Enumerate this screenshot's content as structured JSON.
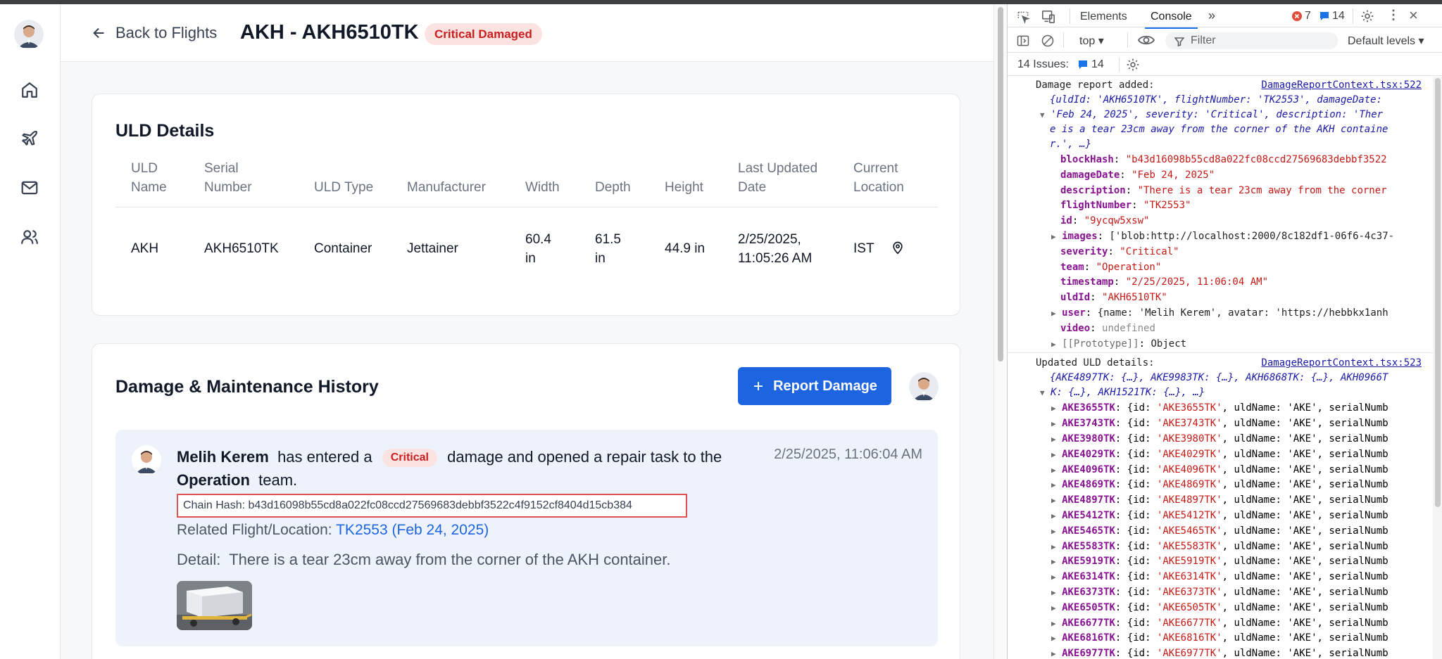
{
  "app": {
    "back_label": "Back to Flights",
    "title": "AKH - AKH6510TK",
    "status_badge": "Critical Damaged",
    "uld_section_title": "ULD Details",
    "uld_headers": [
      "ULD Name",
      "Serial Number",
      "ULD Type",
      "Manufacturer",
      "Width",
      "Depth",
      "Height",
      "Last Updated Date",
      "Current Location"
    ],
    "uld_row": {
      "name": "AKH",
      "serial": "AKH6510TK",
      "type": "Container",
      "manufacturer": "Jettainer",
      "width": "60.4 in",
      "depth": "61.5 in",
      "height": "44.9 in",
      "last_updated": "2/25/2025, 11:05:26 AM",
      "location": "IST"
    },
    "history_title": "Damage & Maintenance History",
    "report_button": "Report Damage",
    "entry": {
      "user": "Melih Kerem",
      "text_1": "has entered a",
      "severity": "Critical",
      "text_2": "damage and opened a repair task to the",
      "team": "Operation",
      "text_3": "team.",
      "timestamp": "2/25/2025, 11:06:04 AM",
      "chain_hash": "Chain Hash: b43d16098b55cd8a022fc08ccd27569683debbf3522c4f9152cf8404d15cb384",
      "related_label": "Related Flight/Location:",
      "related_value": "TK2553 (Feb 24, 2025)",
      "detail_label": "Detail:",
      "detail_text": "There is a tear 23cm away from the corner of the AKH container."
    }
  },
  "devtools": {
    "tabs": [
      "Elements",
      "Console"
    ],
    "error_count": "7",
    "message_count": "14",
    "context": "top",
    "filter_placeholder": "Filter",
    "levels": "Default levels",
    "issues_label": "14 Issues:",
    "issues_count": "14",
    "log1": {
      "label": "Damage report added:",
      "source": "DamageReportContext.tsx:522",
      "summary_1": "{uldId: 'AKH6510TK', flightNumber: 'TK2553', damageDate:",
      "summary_2": "'Feb 24, 2025', severity: 'Critical', description: 'Ther",
      "summary_3": "e is a tear 23cm away from the corner of the AKH containe",
      "summary_4": "r.', …}",
      "props": [
        {
          "key": "blockHash",
          "value": "\"b43d16098b55cd8a022fc08ccd27569683debbf3522",
          "expand": false
        },
        {
          "key": "damageDate",
          "value": "\"Feb 24, 2025\"",
          "expand": false
        },
        {
          "key": "description",
          "value": "\"There is a tear 23cm away from the corner",
          "expand": false
        },
        {
          "key": "flightNumber",
          "value": "\"TK2553\"",
          "expand": false
        },
        {
          "key": "id",
          "value": "\"9ycqw5xsw\"",
          "expand": false
        },
        {
          "key": "images",
          "value": "['blob:http://localhost:2000/8c182df1-06f6-4c37-",
          "expand": true
        },
        {
          "key": "severity",
          "value": "\"Critical\"",
          "expand": false
        },
        {
          "key": "team",
          "value": "\"Operation\"",
          "expand": false
        },
        {
          "key": "timestamp",
          "value": "\"2/25/2025, 11:06:04 AM\"",
          "expand": false
        },
        {
          "key": "uldId",
          "value": "\"AKH6510TK\"",
          "expand": false
        },
        {
          "key": "user",
          "value": "{name: 'Melih Kerem', avatar: 'https://hebbkx1anh",
          "expand": true
        },
        {
          "key": "video",
          "value": "undefined",
          "expand": false
        },
        {
          "key": "[[Prototype]]",
          "value": "Object",
          "expand": true
        }
      ]
    },
    "log2": {
      "label": "Updated ULD details:",
      "source": "DamageReportContext.tsx:523",
      "summary_1": "{AKE4897TK: {…}, AKE9983TK: {…}, AKH6868TK: {…}, AKH0966T",
      "summary_2": "K: {…}, AKH1521TK: {…}, …}",
      "items": [
        "AKE3655TK",
        "AKE3743TK",
        "AKE3980TK",
        "AKE4029TK",
        "AKE4096TK",
        "AKE4869TK",
        "AKE4897TK",
        "AKE5412TK",
        "AKE5465TK",
        "AKE5583TK",
        "AKE5919TK",
        "AKE6314TK",
        "AKE6373TK",
        "AKE6505TK",
        "AKE6677TK",
        "AKE6816TK",
        "AKE6977TK"
      ],
      "item_suffix": "uldName: 'AKE', serialNumb"
    }
  }
}
